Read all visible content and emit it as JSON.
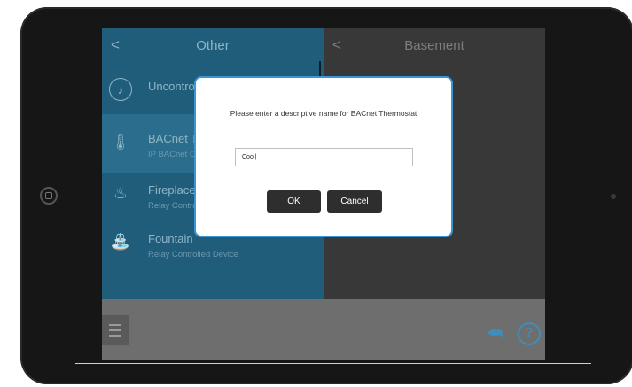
{
  "left_panel": {
    "title": "Other",
    "back_glyph": "<",
    "items": [
      {
        "name": "Uncontrolled",
        "subtitle": "",
        "icon": "music-note-icon"
      },
      {
        "name": "BACnet Th",
        "subtitle": "IP BACnet C",
        "icon": "thermometer-icon"
      },
      {
        "name": "Fireplace",
        "subtitle": "Relay Contro",
        "icon": "flame-icon"
      },
      {
        "name": "Fountain",
        "subtitle": "Relay Controlled Device",
        "icon": "fountain-icon"
      }
    ]
  },
  "right_panel": {
    "title": "Basement",
    "back_glyph": "<"
  },
  "dialog": {
    "message": "Please enter a descriptive name for BACnet Thermostat",
    "input_value": "Cool|",
    "ok_label": "OK",
    "cancel_label": "Cancel"
  },
  "toolbar": {
    "menu_icon": "hamburger-menu-icon",
    "replay_icon": "reply-arrow-icon",
    "help_icon": "help-icon"
  },
  "colors": {
    "accent": "#3b96d6",
    "left_panel_bg": "#1f5d7b",
    "right_panel_bg": "#383838"
  }
}
